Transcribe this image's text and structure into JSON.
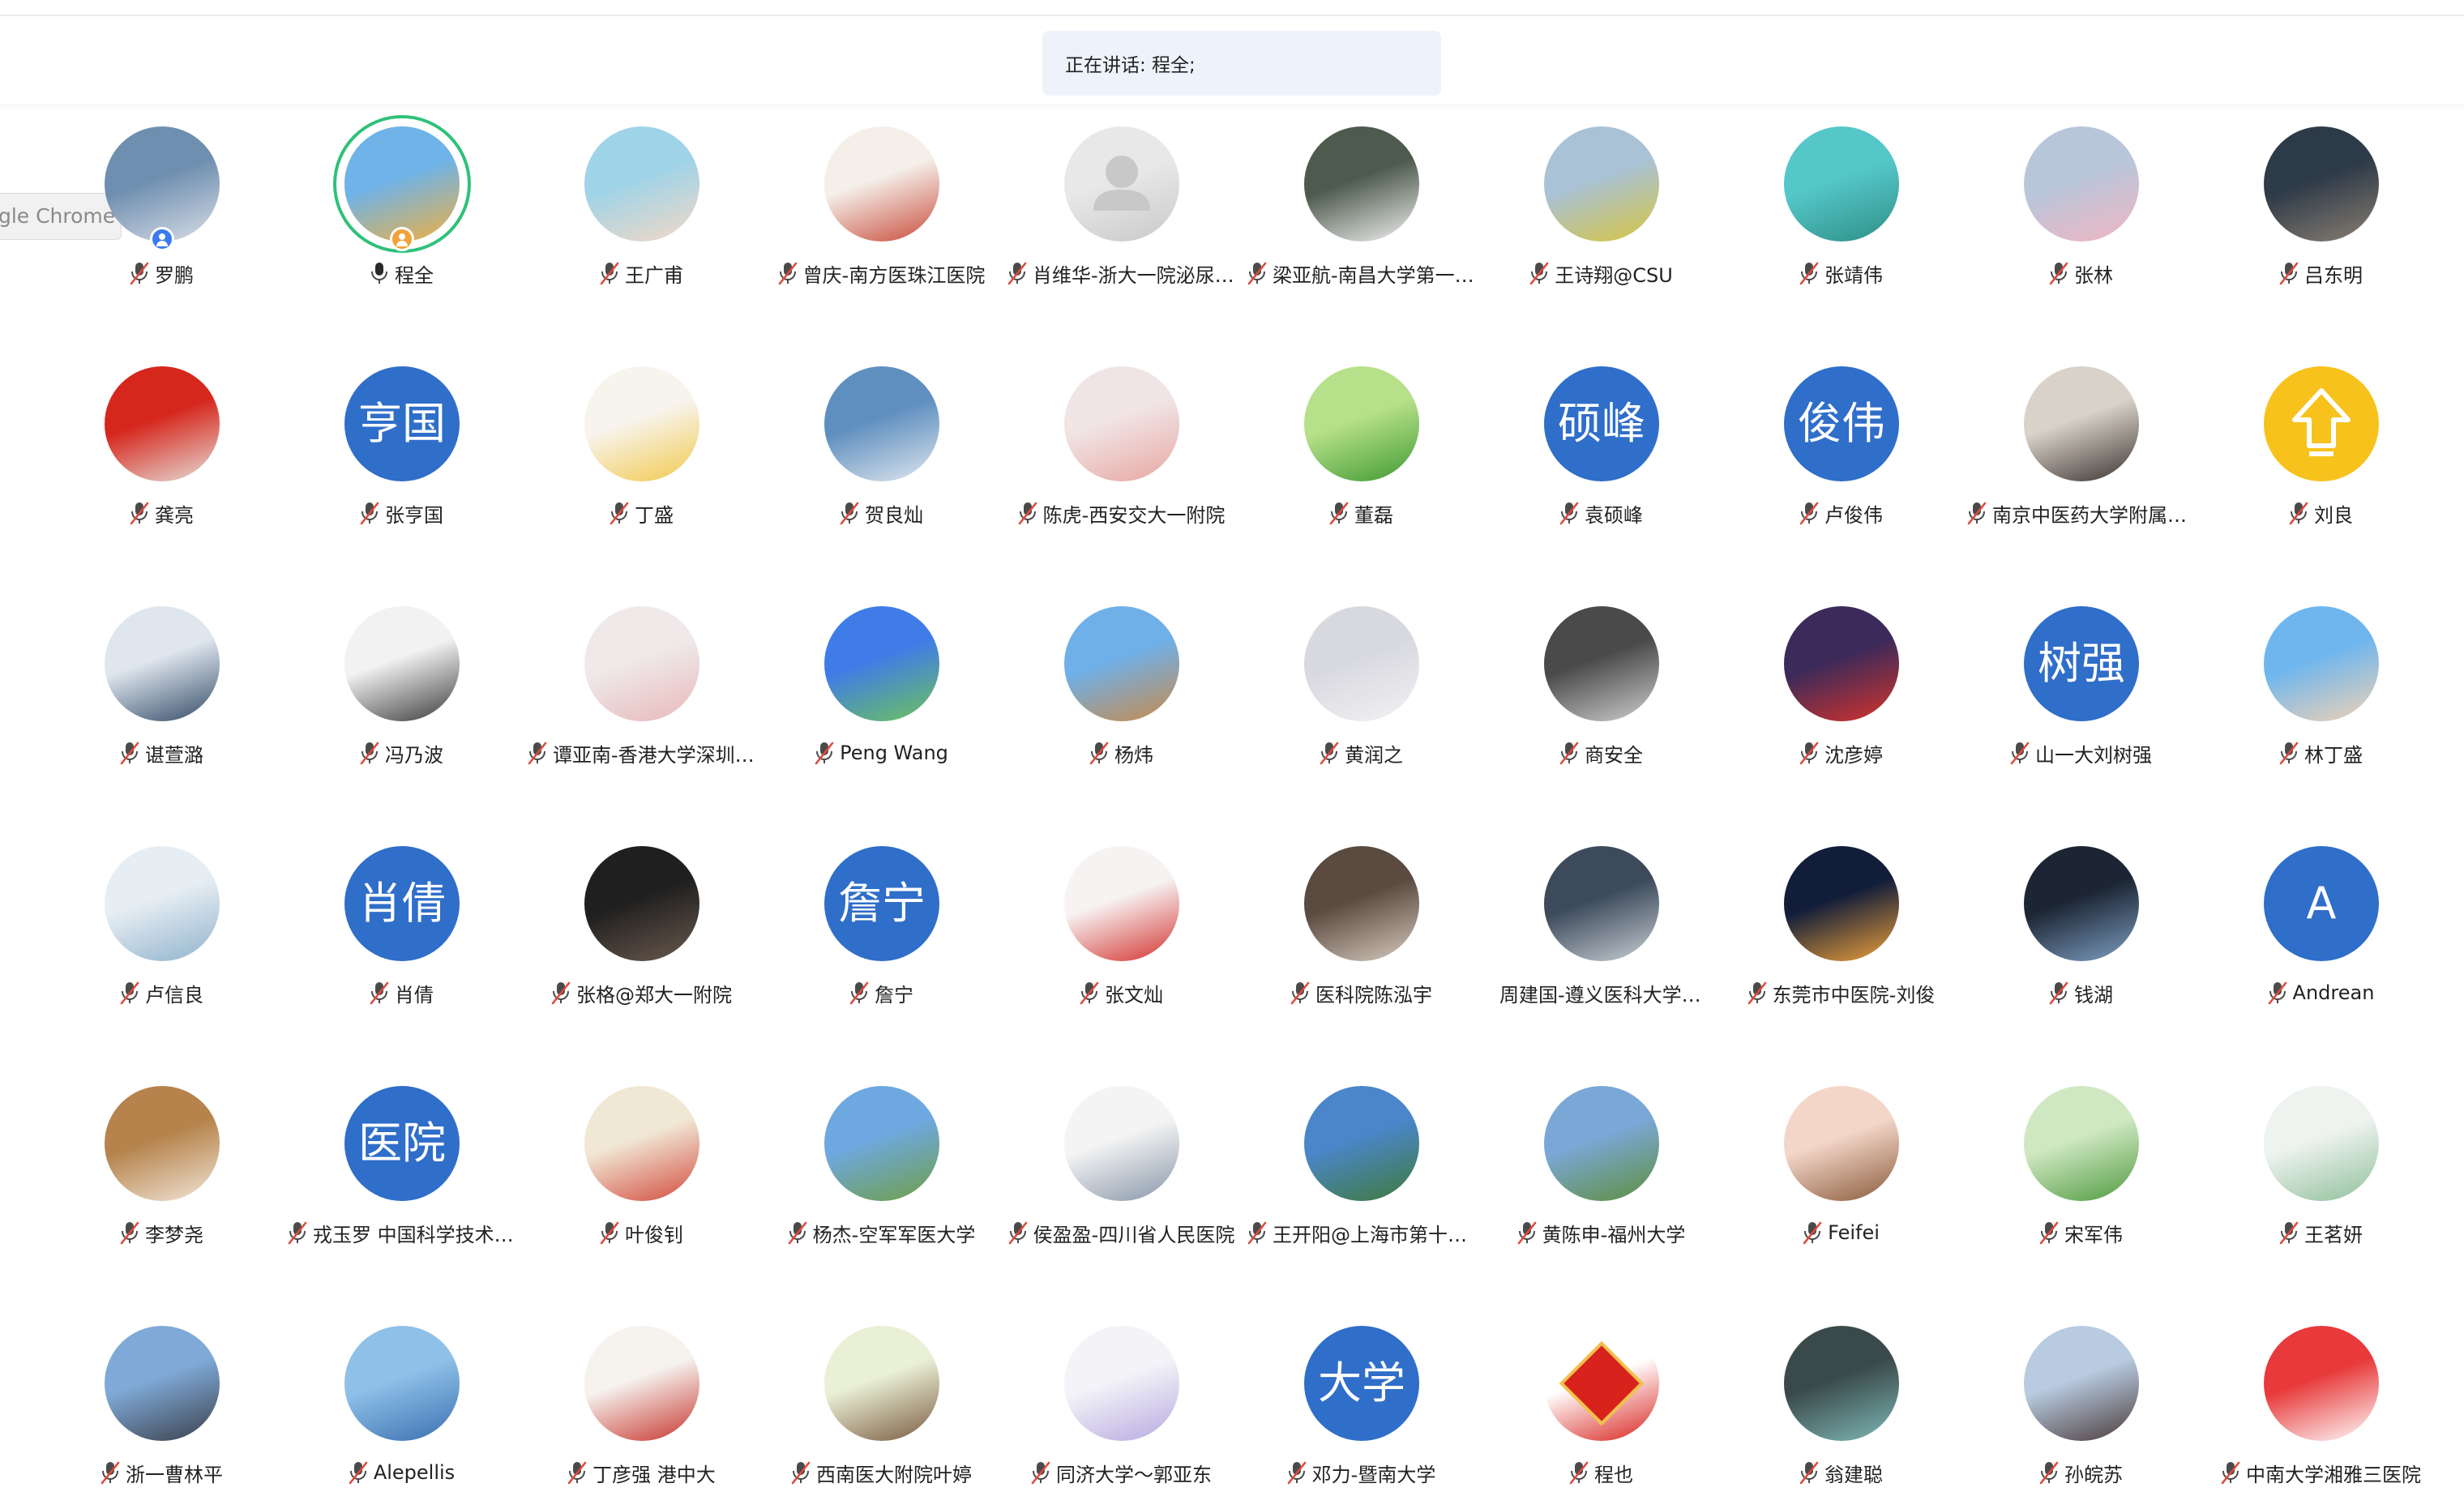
{
  "app": {
    "speaking_banner": "正在讲话: 程全;",
    "chrome_tab_label": "Google Chrome"
  },
  "colors": {
    "text_avatar_bg": "#2f6ec9",
    "active_speaker_ring": "#2fc17a",
    "host_badge": "#3a7bf0",
    "muted_mic_red": "#e0493d",
    "banner_bg": "#eef3fb"
  },
  "participants": [
    {
      "name": "罗鹏",
      "mic": "muted",
      "avatar_text": "",
      "avatar_bg": "#6f8fb0",
      "avatar_bg2": "#d9dee6",
      "badge": "host"
    },
    {
      "name": "程全",
      "mic": "speaking",
      "avatar_text": "",
      "avatar_bg": "#6fb3e8",
      "avatar_bg2": "#f0b040",
      "badge": "cohost",
      "active": true
    },
    {
      "name": "王广甫",
      "mic": "muted",
      "avatar_text": "",
      "avatar_bg": "#9fd3e8",
      "avatar_bg2": "#f3d9c5"
    },
    {
      "name": "曾庆-南方医珠江医院",
      "mic": "muted",
      "avatar_text": "",
      "avatar_bg": "#f4efe9",
      "avatar_bg2": "#c94b3a"
    },
    {
      "name": "肖维华-浙大一院泌尿外科",
      "mic": "muted",
      "avatar_text": "",
      "avatar_bg": "#e8e8e8",
      "avatar_bg2": "#c9c9c9",
      "icon": "default-avatar"
    },
    {
      "name": "梁亚航-南昌大学第一附属医院",
      "mic": "muted",
      "avatar_text": "",
      "avatar_bg": "#4d5a4d",
      "avatar_bg2": "#f2f2f2"
    },
    {
      "name": "王诗翔@CSU",
      "mic": "muted",
      "avatar_text": "",
      "avatar_bg": "#a9c2d6",
      "avatar_bg2": "#d7c540"
    },
    {
      "name": "张靖伟",
      "mic": "muted",
      "avatar_text": "",
      "avatar_bg": "#55c7c9",
      "avatar_bg2": "#2f8f86"
    },
    {
      "name": "张林",
      "mic": "muted",
      "avatar_text": "",
      "avatar_bg": "#b8c6da",
      "avatar_bg2": "#f1b6c2"
    },
    {
      "name": "吕东明",
      "mic": "muted",
      "avatar_text": "",
      "avatar_bg": "#2d3a48",
      "avatar_bg2": "#8a7f72"
    },
    {
      "name": "龚亮",
      "mic": "muted",
      "avatar_text": "",
      "avatar_bg": "#d6271d",
      "avatar_bg2": "#e6e0da"
    },
    {
      "name": "张亨国",
      "mic": "muted",
      "avatar_text": "亨国",
      "avatar_bg": "#2f6ec9",
      "avatar_bg2": "#2f6ec9"
    },
    {
      "name": "丁盛",
      "mic": "muted",
      "avatar_text": "",
      "avatar_bg": "#f7f4ee",
      "avatar_bg2": "#f2c94c"
    },
    {
      "name": "贺良灿",
      "mic": "muted",
      "avatar_text": "",
      "avatar_bg": "#5f8fbf",
      "avatar_bg2": "#dfe7ee"
    },
    {
      "name": "陈虎-西安交大一附院",
      "mic": "muted",
      "avatar_text": "",
      "avatar_bg": "#f0e4e4",
      "avatar_bg2": "#e8a6a2"
    },
    {
      "name": "董磊",
      "mic": "muted",
      "avatar_text": "",
      "avatar_bg": "#b7e08a",
      "avatar_bg2": "#3f9a33"
    },
    {
      "name": "袁硕峰",
      "mic": "muted",
      "avatar_text": "硕峰",
      "avatar_bg": "#2f6ec9",
      "avatar_bg2": "#2f6ec9"
    },
    {
      "name": "卢俊伟",
      "mic": "muted",
      "avatar_text": "俊伟",
      "avatar_bg": "#2f6ec9",
      "avatar_bg2": "#2f6ec9"
    },
    {
      "name": "南京中医药大学附属医院",
      "mic": "muted",
      "avatar_text": "",
      "avatar_bg": "#d9d2c8",
      "avatar_bg2": "#3b3330"
    },
    {
      "name": "刘良",
      "mic": "muted",
      "avatar_text": "",
      "avatar_bg": "#f7c21b",
      "avatar_bg2": "#f7c21b",
      "icon": "arrow-up"
    },
    {
      "name": "谌萱潞",
      "mic": "muted",
      "avatar_text": "",
      "avatar_bg": "#dfe6ee",
      "avatar_bg2": "#324a66"
    },
    {
      "name": "冯乃波",
      "mic": "muted",
      "avatar_text": "",
      "avatar_bg": "#f2f2f2",
      "avatar_bg2": "#3a3a3a"
    },
    {
      "name": "谭亚南-香港大学深圳医院",
      "mic": "muted",
      "avatar_text": "",
      "avatar_bg": "#efe9ea",
      "avatar_bg2": "#e8b8b8"
    },
    {
      "name": "Peng Wang",
      "mic": "muted",
      "avatar_text": "",
      "avatar_bg": "#3f7ce8",
      "avatar_bg2": "#6ec35b"
    },
    {
      "name": "杨炜",
      "mic": "muted",
      "avatar_text": "",
      "avatar_bg": "#6fb0e8",
      "avatar_bg2": "#c98a4b"
    },
    {
      "name": "黄润之",
      "mic": "muted",
      "avatar_text": "",
      "avatar_bg": "#d8d9df",
      "avatar_bg2": "#f2f2f4"
    },
    {
      "name": "商安全",
      "mic": "muted",
      "avatar_text": "",
      "avatar_bg": "#4a4a4a",
      "avatar_bg2": "#cfcfcf"
    },
    {
      "name": "沈彦婷",
      "mic": "muted",
      "avatar_text": "",
      "avatar_bg": "#3b2a5a",
      "avatar_bg2": "#d6332c"
    },
    {
      "name": "山一大刘树强",
      "mic": "muted",
      "avatar_text": "树强",
      "avatar_bg": "#2f6ec9",
      "avatar_bg2": "#2f6ec9"
    },
    {
      "name": "林丁盛",
      "mic": "muted",
      "avatar_text": "",
      "avatar_bg": "#6fb6ee",
      "avatar_bg2": "#f1d2b4"
    },
    {
      "name": "卢信良",
      "mic": "muted",
      "avatar_text": "",
      "avatar_bg": "#e6edf3",
      "avatar_bg2": "#8fb2cc"
    },
    {
      "name": "肖倩",
      "mic": "muted",
      "avatar_text": "肖倩",
      "avatar_bg": "#2f6ec9",
      "avatar_bg2": "#2f6ec9"
    },
    {
      "name": "张格@郑大一附院",
      "mic": "muted",
      "avatar_text": "",
      "avatar_bg": "#1f1f1f",
      "avatar_bg2": "#6b5a4d"
    },
    {
      "name": "詹宁",
      "mic": "muted",
      "avatar_text": "詹宁",
      "avatar_bg": "#2f6ec9",
      "avatar_bg2": "#2f6ec9"
    },
    {
      "name": "张文灿",
      "mic": "muted",
      "avatar_text": "",
      "avatar_bg": "#f7f3f3",
      "avatar_bg2": "#d3322d"
    },
    {
      "name": "医科院陈泓宇",
      "mic": "muted",
      "avatar_text": "",
      "avatar_bg": "#5a4a40",
      "avatar_bg2": "#d8cbbf"
    },
    {
      "name": "周建国-遵义医科大学附属医院",
      "mic": "none",
      "avatar_text": "",
      "avatar_bg": "#3c4a5a",
      "avatar_bg2": "#c9cfd6"
    },
    {
      "name": "东莞市中医院-刘俊",
      "mic": "muted",
      "avatar_text": "",
      "avatar_bg": "#121d3a",
      "avatar_bg2": "#f0a23a"
    },
    {
      "name": "钱湖",
      "mic": "muted",
      "avatar_text": "",
      "avatar_bg": "#1c2533",
      "avatar_bg2": "#7ea0c4"
    },
    {
      "name": "Andrean",
      "mic": "muted",
      "avatar_text": "A",
      "avatar_bg": "#2f6ec9",
      "avatar_bg2": "#2f6ec9"
    },
    {
      "name": "李梦尧",
      "mic": "muted",
      "avatar_text": "",
      "avatar_bg": "#b5834b",
      "avatar_bg2": "#f2e6d8"
    },
    {
      "name": "戎玉罗 中国科学技术大学附属第一医院",
      "mic": "muted",
      "avatar_text": "医院",
      "avatar_bg": "#2f6ec9",
      "avatar_bg2": "#2f6ec9"
    },
    {
      "name": "叶俊钊",
      "mic": "muted",
      "avatar_text": "",
      "avatar_bg": "#f1e7d5",
      "avatar_bg2": "#d24a3c"
    },
    {
      "name": "杨杰-空军军医大学",
      "mic": "muted",
      "avatar_text": "",
      "avatar_bg": "#6ea8e0",
      "avatar_bg2": "#6f9f45"
    },
    {
      "name": "侯盈盈-四川省人民医院",
      "mic": "muted",
      "avatar_text": "",
      "avatar_bg": "#f4f4f4",
      "avatar_bg2": "#8796a8"
    },
    {
      "name": "王开阳@上海市第十人民医院",
      "mic": "muted",
      "avatar_text": "",
      "avatar_bg": "#4a86c9",
      "avatar_bg2": "#3f7a3a"
    },
    {
      "name": "黄陈申-福州大学",
      "mic": "muted",
      "avatar_text": "",
      "avatar_bg": "#7aa7d6",
      "avatar_bg2": "#5e8f3d"
    },
    {
      "name": "Feifei",
      "mic": "muted",
      "avatar_text": "",
      "avatar_bg": "#f3d6c8",
      "avatar_bg2": "#8a5a3a"
    },
    {
      "name": "宋军伟",
      "mic": "muted",
      "avatar_text": "",
      "avatar_bg": "#cfe8c2",
      "avatar_bg2": "#4f9a3f"
    },
    {
      "name": "王茗妍",
      "mic": "muted",
      "avatar_text": "",
      "avatar_bg": "#eef3ef",
      "avatar_bg2": "#8fbf9a"
    },
    {
      "name": "浙一曹林平",
      "mic": "muted",
      "avatar_text": "",
      "avatar_bg": "#7fa9d6",
      "avatar_bg2": "#3a3f4a"
    },
    {
      "name": "Alepellis",
      "mic": "muted",
      "avatar_text": "",
      "avatar_bg": "#8fc0e8",
      "avatar_bg2": "#3a6fb0"
    },
    {
      "name": "丁彦强 港中大",
      "mic": "muted",
      "avatar_text": "",
      "avatar_bg": "#f6f2ee",
      "avatar_bg2": "#c6342c"
    },
    {
      "name": "西南医大附院叶婷",
      "mic": "muted",
      "avatar_text": "",
      "avatar_bg": "#e9f0d6",
      "avatar_bg2": "#7a5a3f"
    },
    {
      "name": "同济大学～郭亚东",
      "mic": "muted",
      "avatar_text": "",
      "avatar_bg": "#f4f4f8",
      "avatar_bg2": "#b6a9e0"
    },
    {
      "name": "邓力-暨南大学",
      "mic": "muted",
      "avatar_text": "大学",
      "avatar_bg": "#2f6ec9",
      "avatar_bg2": "#2f6ec9"
    },
    {
      "name": "程也",
      "mic": "muted",
      "avatar_text": "",
      "avatar_bg": "#ffffff",
      "avatar_bg2": "#d8231d",
      "icon": "fu-diamond"
    },
    {
      "name": "翁建聪",
      "mic": "muted",
      "avatar_text": "",
      "avatar_bg": "#3a4a4a",
      "avatar_bg2": "#7fb8b8"
    },
    {
      "name": "孙皖苏",
      "mic": "muted",
      "avatar_text": "",
      "avatar_bg": "#b8cbe0",
      "avatar_bg2": "#4a3a3a"
    },
    {
      "name": "中南大学湘雅三医院",
      "mic": "muted",
      "avatar_text": "",
      "avatar_bg": "#e83a3a",
      "avatar_bg2": "#ffffff"
    }
  ]
}
